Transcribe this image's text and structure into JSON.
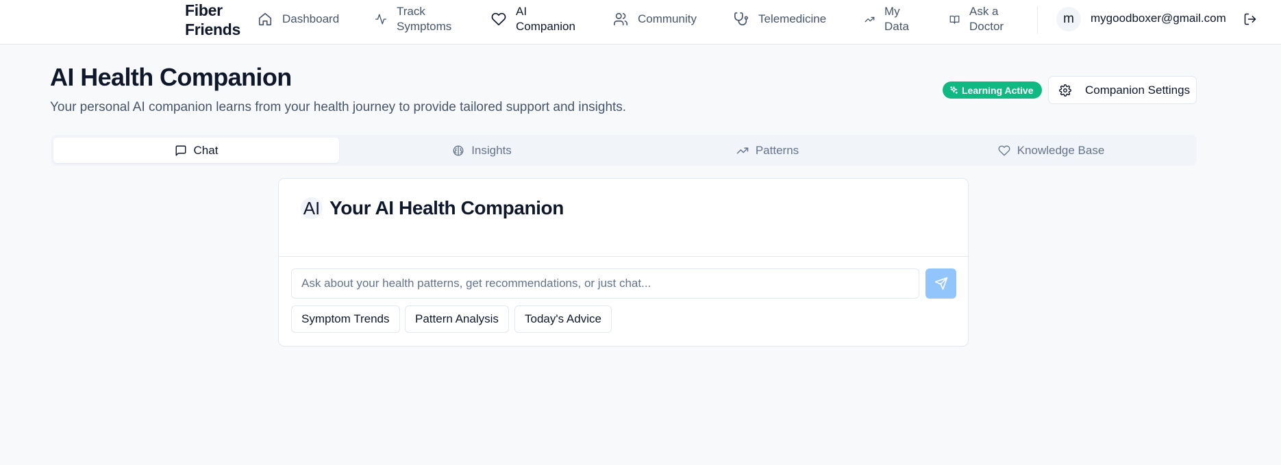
{
  "brand": {
    "line1": "Fiber",
    "line2": "Friends"
  },
  "nav": {
    "items": [
      {
        "label": "Dashboard",
        "icon": "home-icon"
      },
      {
        "label": "Track Symptoms",
        "icon": "activity-icon"
      },
      {
        "label": "AI Companion",
        "icon": "heart-icon",
        "active": true
      },
      {
        "label": "Community",
        "icon": "users-icon"
      },
      {
        "label": "Telemedicine",
        "icon": "stethoscope-icon"
      },
      {
        "label": "My Data",
        "icon": "trending-up-icon"
      },
      {
        "label": "Ask a Doctor",
        "icon": "book-open-icon"
      }
    ],
    "user": {
      "avatar_letter": "m",
      "email": "mygoodboxer@gmail.com"
    }
  },
  "header": {
    "title": "AI Health Companion",
    "subtitle": "Your personal AI companion learns from your health journey to provide tailored support and insights.",
    "badge": "Learning Active",
    "settings_label": "Companion Settings"
  },
  "tabs": [
    {
      "label": "Chat",
      "icon": "message-square-icon",
      "active": true
    },
    {
      "label": "Insights",
      "icon": "brain-icon"
    },
    {
      "label": "Patterns",
      "icon": "trending-up-icon"
    },
    {
      "label": "Knowledge Base",
      "icon": "heart-icon"
    }
  ],
  "chat": {
    "avatar_text": "AI",
    "title": "Your AI Health Companion",
    "input_placeholder": "Ask about your health patterns, get recommendations, or just chat...",
    "input_value": "",
    "quick_actions": [
      "Symptom Trends",
      "Pattern Analysis",
      "Today's Advice"
    ]
  },
  "colors": {
    "accent_green": "#10b981",
    "send_button": "#93c5fd",
    "background": "#f8f9fb"
  }
}
